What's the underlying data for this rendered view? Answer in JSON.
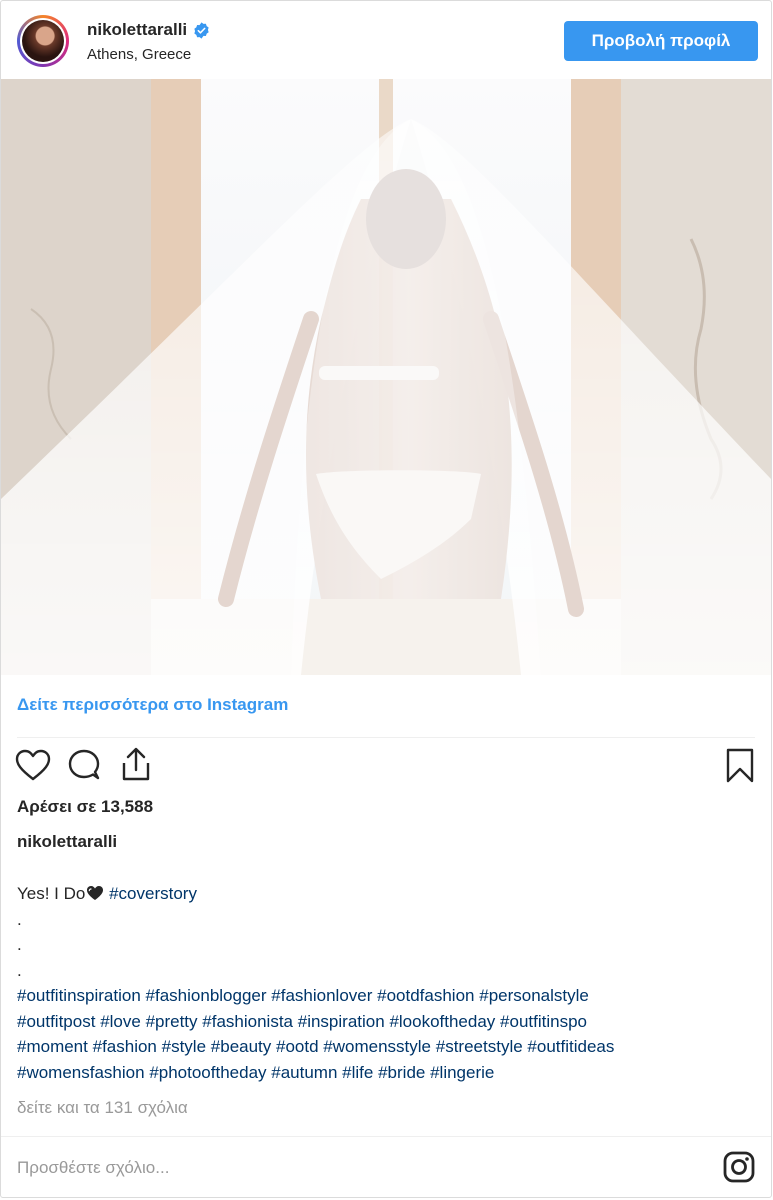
{
  "header": {
    "username": "nikolettaralli",
    "verified": true,
    "location": "Athens, Greece",
    "profile_button": "Προβολή προφίλ"
  },
  "media": {
    "type": "photo"
  },
  "view_more_link": "Δείτε περισσότερα στο Instagram",
  "actions": {
    "like_icon": "heart-icon",
    "comment_icon": "comment-icon",
    "share_icon": "share-icon",
    "save_icon": "bookmark-icon"
  },
  "likes_text": "Αρέσει σε 13,588",
  "caption": {
    "username": "nikolettaralli",
    "intro_text": "Yes! I Do",
    "intro_emoji": "heart",
    "intro_tag": "#coverstory",
    "dots": [
      ".",
      ".",
      "."
    ],
    "hashtag_lines": [
      [
        "#outfitinspiration",
        "#fashionblogger",
        "#fashionlover",
        "#ootdfashion",
        "#personalstyle"
      ],
      [
        "#outfitpost",
        "#love",
        "#pretty",
        "#fashionista",
        "#inspiration",
        "#lookoftheday",
        "#outfitinspo"
      ],
      [
        "#moment",
        "#fashion",
        "#style",
        "#beauty",
        "#ootd",
        "#womensstyle",
        "#streetstyle",
        "#outfitideas"
      ],
      [
        "#womensfashion",
        "#photooftheday",
        "#autumn",
        "#life",
        "#bride",
        "#lingerie"
      ]
    ]
  },
  "view_comments": "δείτε και τα 131 σχόλια",
  "comment_placeholder": "Προσθέστε σχόλιο...",
  "colors": {
    "accent_blue": "#3897f0",
    "hashtag": "#003569",
    "muted": "#999999",
    "text": "#262626"
  }
}
